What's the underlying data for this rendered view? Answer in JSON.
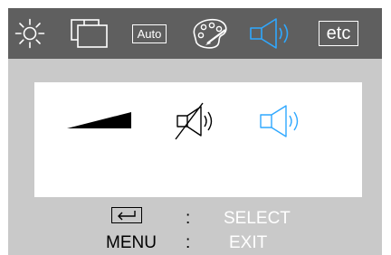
{
  "menu": {
    "tabs": [
      {
        "id": "brightness",
        "icon": "sun-icon",
        "selected": false
      },
      {
        "id": "picture",
        "icon": "picture-frames-icon",
        "selected": false
      },
      {
        "id": "auto",
        "label": "Auto",
        "icon": "auto-icon",
        "selected": false
      },
      {
        "id": "color",
        "icon": "palette-icon",
        "selected": false
      },
      {
        "id": "audio",
        "icon": "speaker-icon",
        "selected": true
      },
      {
        "id": "etc",
        "label": "etc",
        "icon": "etc-icon",
        "selected": false
      }
    ]
  },
  "audio": {
    "options": [
      {
        "id": "volume",
        "icon": "volume-ramp-icon"
      },
      {
        "id": "mute",
        "icon": "speaker-muted-icon"
      },
      {
        "id": "unmute",
        "icon": "speaker-icon",
        "selected": true
      }
    ]
  },
  "legend": {
    "select_key": "↵",
    "separator": ":",
    "select_label": "SELECT",
    "menu_key": "MENU",
    "exit_label": "EXIT"
  },
  "colors": {
    "topbar": "#5f5f5f",
    "panel": "#c9c9c9",
    "accent": "#2fa8ff",
    "icon_light": "#ffffff",
    "icon_dark": "#000000"
  }
}
